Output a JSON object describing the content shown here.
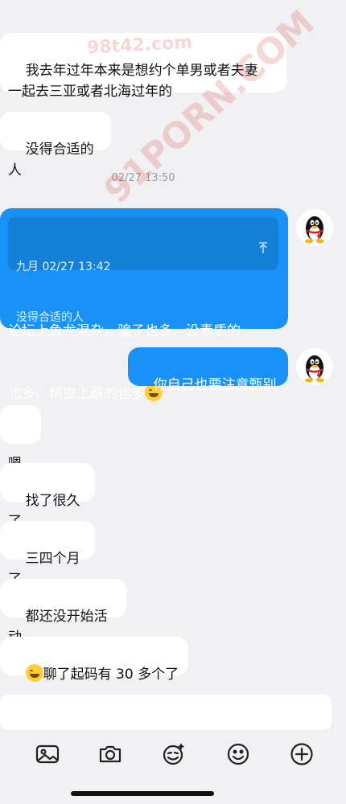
{
  "messages": {
    "m1": "我去年过年本来是想约个单男或者夫妻\n一起去三亚或者北海过年的",
    "m2": "没得合适的人",
    "timestamp": "02/27 13:50",
    "reply": {
      "quote_meta": "九月 02/27 13:42",
      "quote_text": "没得合适的人",
      "text_line1": "论坛上鱼龙混杂，骗子也多。没素质的",
      "text_line2": "也多。精虫上脑的也多"
    },
    "m3": "你自己也要注意甄别",
    "m4": "嗯",
    "m5": "找了很久了",
    "m6": "三四个月了",
    "m7": "都还没开始活动",
    "m8": "聊了起码有 30 多个了"
  },
  "watermarks": {
    "w1": "98t42.com",
    "w2": "91PORN.COM"
  },
  "icons": {
    "image": "image-icon",
    "camera": "camera-icon",
    "sticker": "sticker-icon",
    "emoji": "emoji-icon",
    "add": "add-icon",
    "up_arrow": "arrow-up-icon"
  },
  "colors": {
    "bubble_blue": "#1892f7",
    "background": "#f1f1f3"
  }
}
